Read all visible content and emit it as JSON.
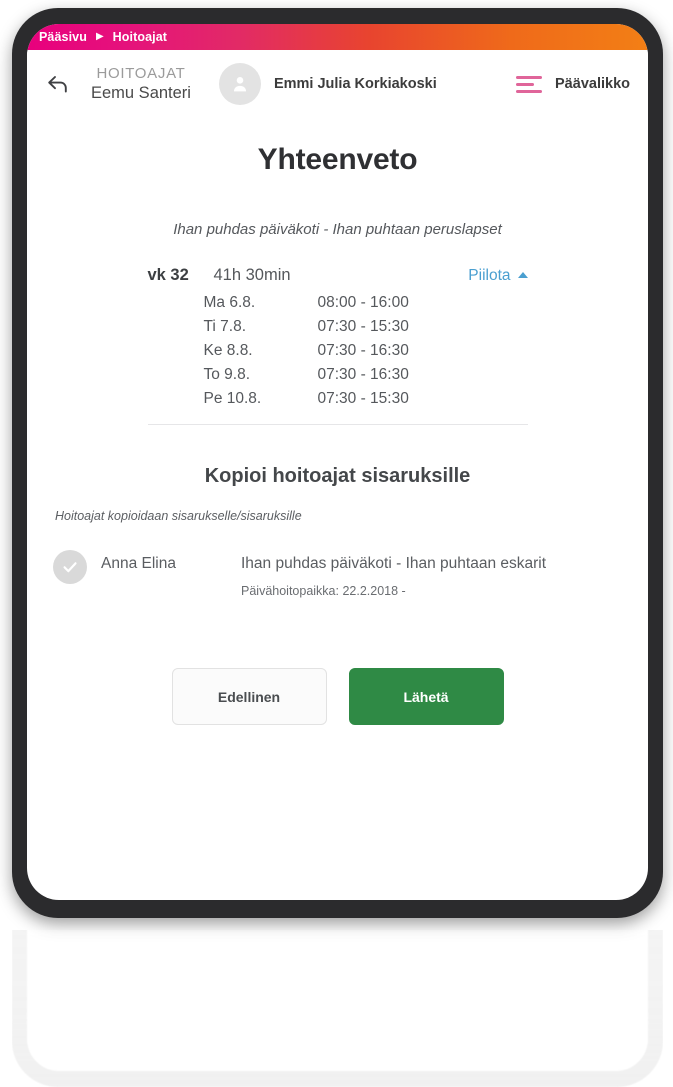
{
  "breadcrumb": {
    "items": [
      "Pääsivu",
      "Hoitoajat"
    ],
    "separator": "▶",
    "gradient_start": "#e8007d",
    "gradient_end": "#f37f15"
  },
  "header": {
    "back_icon": "back-arrow-icon",
    "context_kicker": "HOITOAJAT",
    "context_name": "Eemu Santeri",
    "avatar_icon": "person-icon",
    "user_name": "Emmi Julia Korkiakoski",
    "menu_icon": "hamburger-icon",
    "menu_label": "Päävalikko",
    "menu_icon_color": "#e0659a"
  },
  "main": {
    "title": "Yhteenveto",
    "subtitle": "Ihan puhdas päiväkoti - Ihan puhtaan peruslapset"
  },
  "week": {
    "label": "vk 32",
    "total_hours": "41h 30min",
    "toggle_label": "Piilota",
    "toggle_icon": "caret-up-icon",
    "toggle_color": "#4a9fd0",
    "days": [
      {
        "day": "Ma 6.8.",
        "time": "08:00 - 16:00"
      },
      {
        "day": "Ti 7.8.",
        "time": "07:30 - 15:30"
      },
      {
        "day": "Ke 8.8.",
        "time": "07:30 - 16:30"
      },
      {
        "day": "To 9.8.",
        "time": "07:30 - 16:30"
      },
      {
        "day": "Pe 10.8.",
        "time": "07:30 - 15:30"
      }
    ]
  },
  "copy_section": {
    "title": "Kopioi hoitoajat sisaruksille",
    "note": "Hoitoajat kopioidaan sisarukselle/sisaruksille",
    "sibling": {
      "checkbox_icon": "check-circle-icon",
      "checkbox_color": "#d9d9d9",
      "name": "Anna Elina",
      "place": "Ihan puhdas päiväkoti - Ihan puhtaan eskarit",
      "meta": "Päivähoitopaikka: 22.2.2018 -"
    }
  },
  "actions": {
    "previous_label": "Edellinen",
    "submit_label": "Lähetä",
    "submit_color": "#2f8a45"
  }
}
